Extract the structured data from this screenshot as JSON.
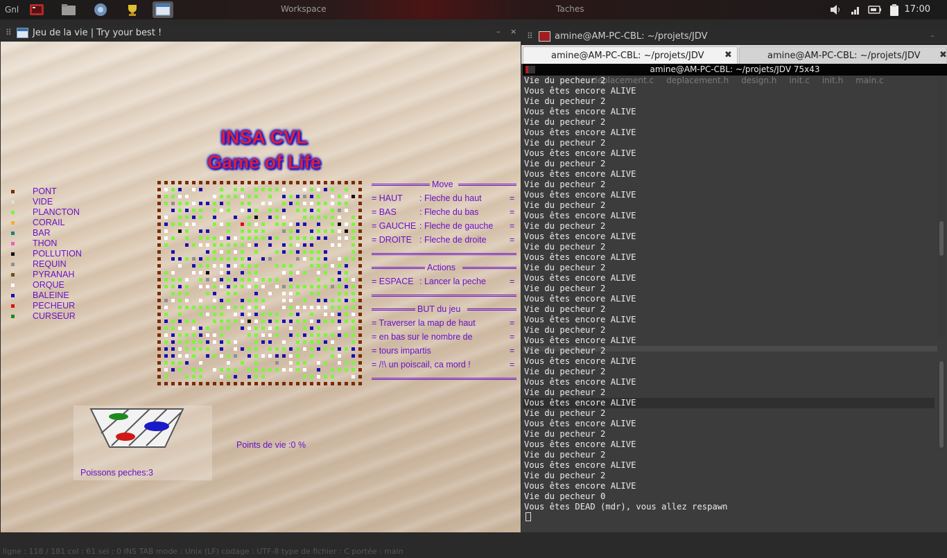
{
  "panel": {
    "menu_label": "Gnl",
    "launchers": [
      {
        "name": "terminal-launcher-icon",
        "color": "#b02a2a"
      },
      {
        "name": "file-manager-icon",
        "color": "#9a9a9a"
      },
      {
        "name": "chromium-icon",
        "color": "#6d8fb8"
      },
      {
        "name": "trophy-app-icon",
        "color": "#e0c030"
      },
      {
        "name": "window-icon",
        "color": "#4a78b8"
      }
    ],
    "workspace_label": "Workspace",
    "tasks_label": "Taches",
    "clock": "17:00"
  },
  "game_window": {
    "title": "Jeu de la vie | Try your best !",
    "minimize": "–",
    "close": "×",
    "logo_line1": "INSA CVL",
    "logo_line2": "Game of Life",
    "legend": [
      {
        "label": "PONT",
        "color": "#7a2a00"
      },
      {
        "label": "VIDE",
        "color": "#e8dccd"
      },
      {
        "label": "PLANCTON",
        "color": "#7cf63c"
      },
      {
        "label": "CORAIL",
        "color": "#f5b030"
      },
      {
        "label": "BAR",
        "color": "#1a8080"
      },
      {
        "label": "THON",
        "color": "#ee60c0"
      },
      {
        "label": "POLLUTION",
        "color": "#101010"
      },
      {
        "label": "REQUIN",
        "color": "#909090"
      },
      {
        "label": "PYRANAH",
        "color": "#6a5020"
      },
      {
        "label": "ORQUE",
        "color": "#ffffff"
      },
      {
        "label": "BALEINE",
        "color": "#1a10b0"
      },
      {
        "label": "PECHEUR",
        "color": "#e01010"
      },
      {
        "label": "CURSEUR",
        "color": "#1a8a1a"
      }
    ],
    "move_header": "Move",
    "move_rows": [
      {
        "key": "= HAUT",
        "desc": ": Fleche du haut",
        "end": "="
      },
      {
        "key": "= BAS",
        "desc": ": Fleche du bas",
        "end": "="
      },
      {
        "key": "= GAUCHE",
        "desc": ": Fleche de gauche",
        "end": "="
      },
      {
        "key": "= DROITE",
        "desc": ": Fleche de droite",
        "end": "="
      }
    ],
    "actions_header": "Actions",
    "actions_rows": [
      {
        "key": "= ESPACE",
        "desc": ": Lancer la peche",
        "end": "="
      }
    ],
    "but_header": "BUT du jeu",
    "but_rows": [
      {
        "text": "= Traverser la map  de haut",
        "end": "="
      },
      {
        "text": "= en bas sur le nombre de",
        "end": "="
      },
      {
        "text": "= tours impartis",
        "end": "="
      },
      {
        "text": "= /!\\ un poiscail, ca mord !",
        "end": "="
      }
    ],
    "fish_caught": "Poissons peches:3",
    "health": "Points de vie :0    %",
    "editor_ghost": "ligne : 118 / 181       col : 61       sel : 0        INS         TAB         mode : Unix (LF)        codage : UTF-8        type de fichier : C        portée : main"
  },
  "terminal_window": {
    "title": "amine@AM-PC-CBL: ~/projets/JDV",
    "tabs": [
      {
        "label": "amine@AM-PC-CBL: ~/projets/JDV",
        "active": true
      },
      {
        "label": "amine@AM-PC-CBL: ~/projets/JDV",
        "active": false
      }
    ],
    "inner_title": "amine@AM-PC-CBL: ~/projets/JDV 75x43",
    "ghost_tabs": [
      "deplacement.c",
      "deplacement.h",
      "design.h",
      "init.c",
      "init.h",
      "main.c"
    ],
    "lines": [
      "Vie du pecheur 2",
      "Vous êtes encore ALIVE",
      "Vie du pecheur 2",
      "Vous êtes encore ALIVE",
      "Vie du pecheur 2",
      "Vous êtes encore ALIVE",
      "Vie du pecheur 2",
      "Vous êtes encore ALIVE",
      "Vie du pecheur 2",
      "Vous êtes encore ALIVE",
      "Vie du pecheur 2",
      "Vous êtes encore ALIVE",
      "Vie du pecheur 2",
      "Vous êtes encore ALIVE",
      "Vie du pecheur 2",
      "Vous êtes encore ALIVE",
      "Vie du pecheur 2",
      "Vous êtes encore ALIVE",
      "Vie du pecheur 2",
      "Vous êtes encore ALIVE",
      "Vie du pecheur 2",
      "Vous êtes encore ALIVE",
      "Vie du pecheur 2",
      "Vous êtes encore ALIVE",
      "Vie du pecheur 2",
      "Vous êtes encore ALIVE",
      "Vie du pecheur 2",
      "Vous êtes encore ALIVE",
      "Vie du pecheur 2",
      "Vous êtes encore ALIVE",
      "Vie du pecheur 2",
      "Vous êtes encore ALIVE",
      "Vie du pecheur 2",
      "Vous êtes encore ALIVE",
      "Vie du pecheur 2",
      "Vous êtes encore ALIVE",
      "Vie du pecheur 2",
      "Vous êtes encore ALIVE",
      "Vie du pecheur 2",
      "Vous êtes encore ALIVE",
      "Vie du pecheur 0",
      "Vous êtes DEAD (mdr), vous allez respawn"
    ]
  }
}
